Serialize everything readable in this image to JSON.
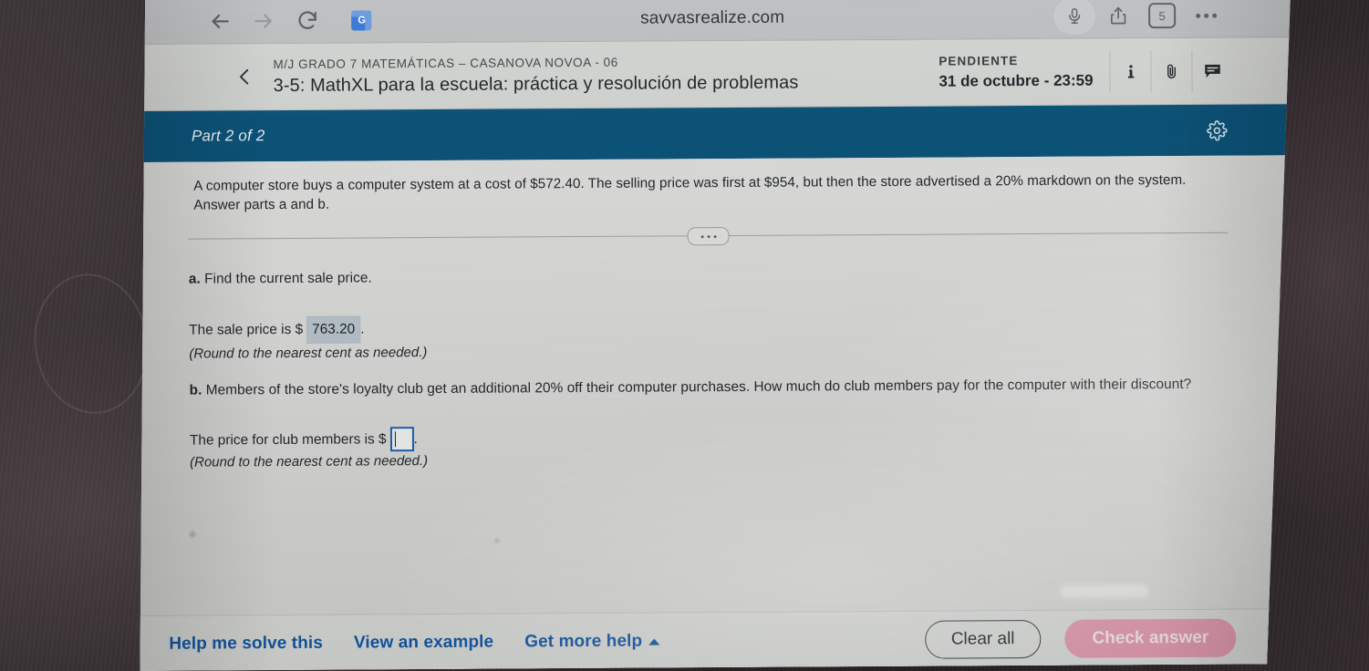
{
  "browser": {
    "back_icon": "arrow-left-icon",
    "forward_icon": "arrow-right-icon",
    "reload_icon": "reload-icon",
    "translate_badge": "G",
    "url": "savvasrealize.com",
    "mic_icon": "microphone-icon",
    "share_icon": "share-icon",
    "tab_count": "5",
    "more_icon": "more-options-icon"
  },
  "assignment_header": {
    "back_label": "back-chevron",
    "course": "M/J GRADO 7 MATEMÁTICAS – CASANOVA NOVOA - 06",
    "title": "3-5: MathXL para la escuela: práctica y resolución de problemas",
    "status": "PENDIENTE",
    "due": "31 de octubre - 23:59",
    "icons": [
      "info-icon",
      "paperclip-icon",
      "comment-icon"
    ]
  },
  "part_bar": {
    "label": "Part 2 of 2",
    "settings_icon": "gear-icon",
    "color": "#0a5177"
  },
  "problem": {
    "stem": "A computer store buys a computer system at a cost of $572.40. The selling price was first at $954, but then the store advertised a 20% markdown on the system. Answer parts a and b.",
    "expander_icon": "ellipsis-expander",
    "part_a": {
      "label": "a.",
      "question": "Find the current sale price.",
      "answer_prefix": "The sale price is $",
      "answer_value": "763.20",
      "answer_suffix": ".",
      "note": "(Round to the nearest cent as needed.)"
    },
    "part_b": {
      "label": "b.",
      "question": "Members of the store's loyalty club get an additional 20% off their computer purchases. How much do club members pay for the computer with their discount?",
      "answer_prefix": "The price for club members is $",
      "answer_value": "",
      "answer_suffix": ".",
      "note": "(Round to the nearest cent as needed.)"
    }
  },
  "footer": {
    "help_me_solve": "Help me solve this",
    "view_example": "View an example",
    "get_more_help": "Get more help",
    "get_more_help_caret": "caret-up-icon",
    "clear_all": "Clear all",
    "check_answer": "Check answer",
    "check_answer_color": "#e59bb0"
  }
}
